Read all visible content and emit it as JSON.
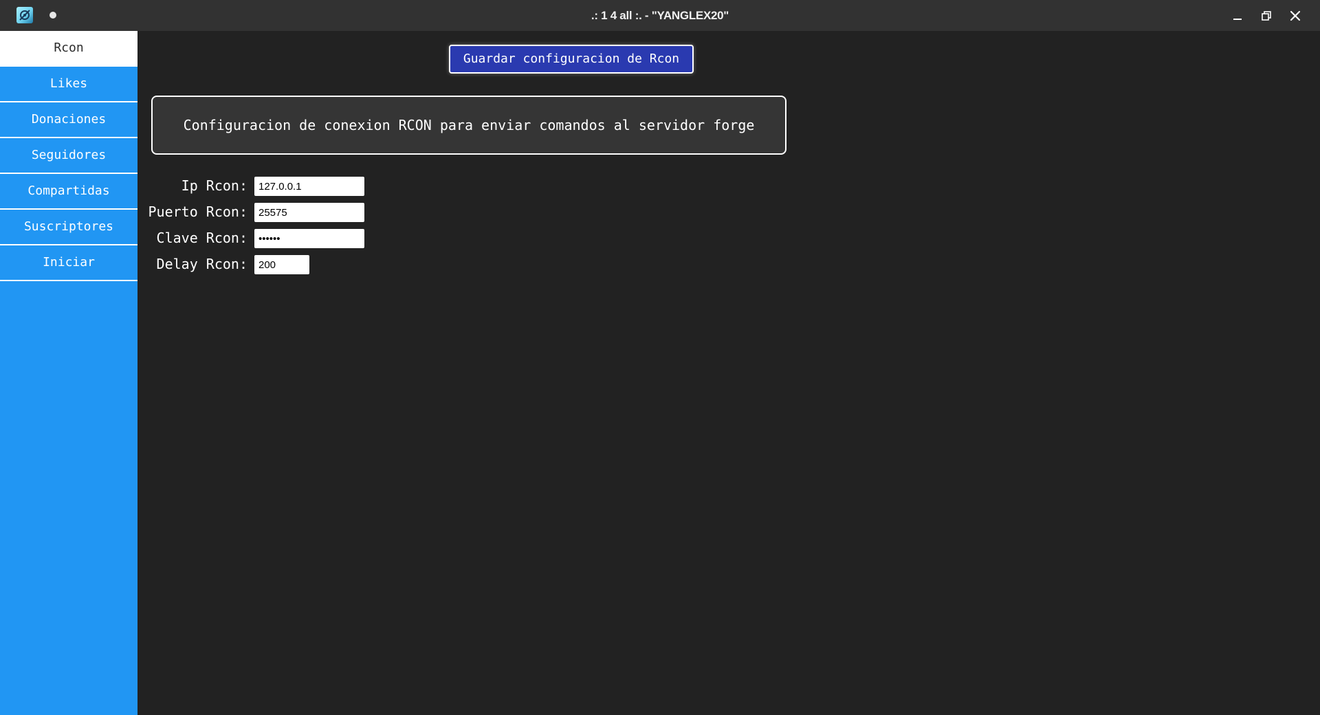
{
  "window": {
    "title": ".: 1 4 all :. - \"YANGLEX20\"",
    "app_icon": "app-logo-icon",
    "controls": [
      "minimize-icon",
      "restore-icon",
      "close-icon"
    ]
  },
  "sidebar": {
    "items": [
      {
        "label": "Rcon",
        "active": true
      },
      {
        "label": "Likes",
        "active": false
      },
      {
        "label": "Donaciones",
        "active": false
      },
      {
        "label": "Seguidores",
        "active": false
      },
      {
        "label": "Compartidas",
        "active": false
      },
      {
        "label": "Suscriptores",
        "active": false
      },
      {
        "label": "Iniciar",
        "active": false
      }
    ]
  },
  "main": {
    "save_button": "Guardar configuracion de Rcon",
    "info_text": "Configuracion de conexion RCON para enviar comandos al servidor forge",
    "fields": {
      "ip": {
        "label": "Ip Rcon:",
        "value": "127.0.0.1"
      },
      "port": {
        "label": "Puerto Rcon:",
        "value": "25575"
      },
      "password": {
        "label": "Clave Rcon:",
        "value": "••••••"
      },
      "delay": {
        "label": "Delay Rcon:",
        "value": "200"
      }
    }
  },
  "colors": {
    "sidebar": "#2196f3",
    "background": "#222222",
    "titlebar": "#323232",
    "button": "#2a3ab0"
  }
}
